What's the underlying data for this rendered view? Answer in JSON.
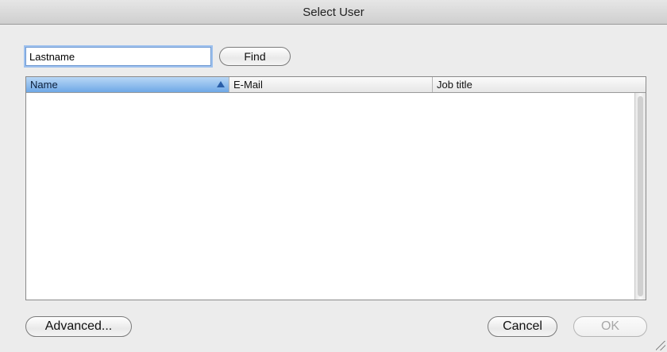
{
  "window": {
    "title": "Select User"
  },
  "search": {
    "value": "Lastname",
    "find_label": "Find"
  },
  "table": {
    "columns": [
      {
        "label": "Name",
        "sorted": "ascending"
      },
      {
        "label": "E-Mail"
      },
      {
        "label": "Job title"
      }
    ],
    "rows": []
  },
  "buttons": {
    "advanced": "Advanced...",
    "cancel": "Cancel",
    "ok": "OK"
  },
  "colors": {
    "accent": "#6fa8e6",
    "focus_ring": "#9ec1ee"
  }
}
